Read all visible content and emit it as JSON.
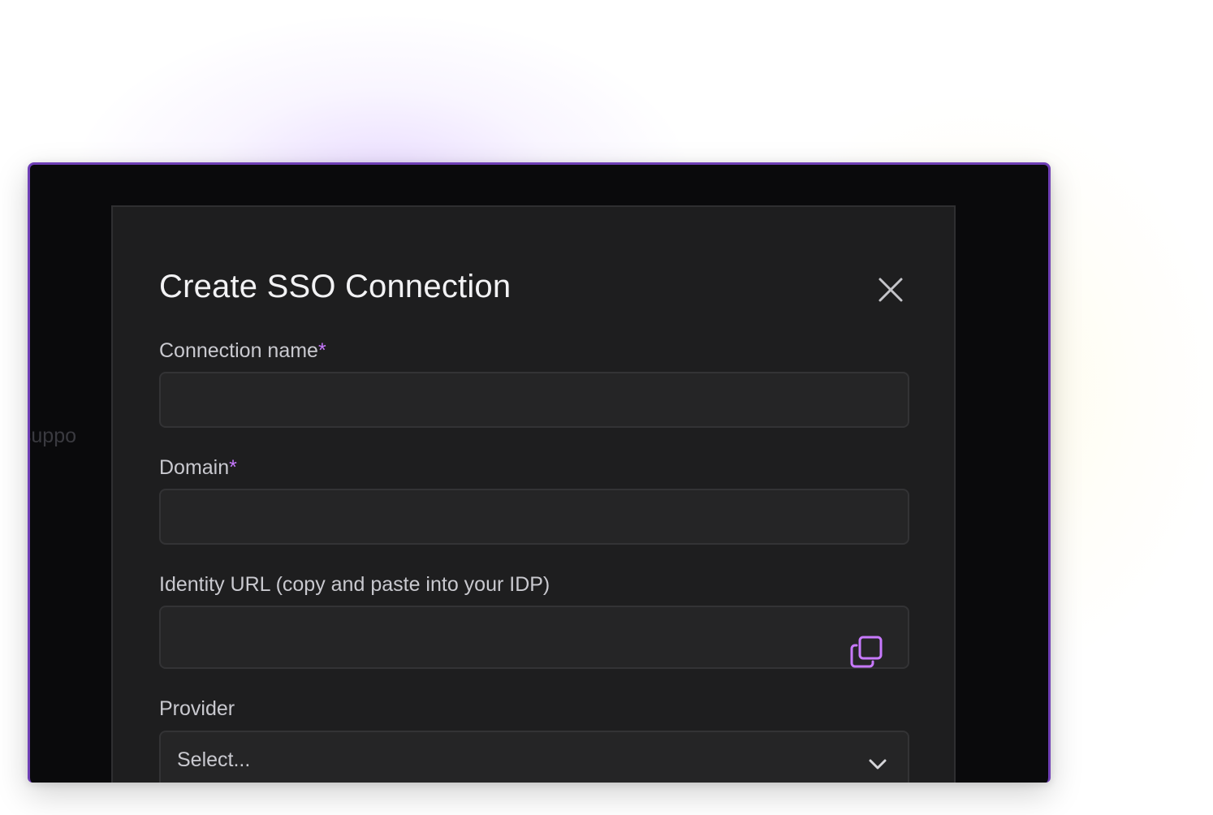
{
  "background": {
    "partial_text": "t suppo"
  },
  "modal": {
    "title": "Create SSO Connection",
    "close_icon": "close-icon",
    "fields": {
      "connection_name": {
        "label": "Connection name",
        "required_mark": "*",
        "value": ""
      },
      "domain": {
        "label": "Domain",
        "required_mark": "*",
        "value": ""
      },
      "identity_url": {
        "label": "Identity URL (copy and paste into your IDP)",
        "value": "",
        "action_icon": "copy-icon"
      },
      "provider": {
        "label": "Provider",
        "selected": "Select...",
        "icon": "chevron-down-icon"
      }
    }
  },
  "colors": {
    "accent": "#c879ff",
    "window_border": "#6f3fb6",
    "modal_background": "#1e1e1f",
    "input_background": "#252526",
    "app_background": "#0a0a0c"
  }
}
